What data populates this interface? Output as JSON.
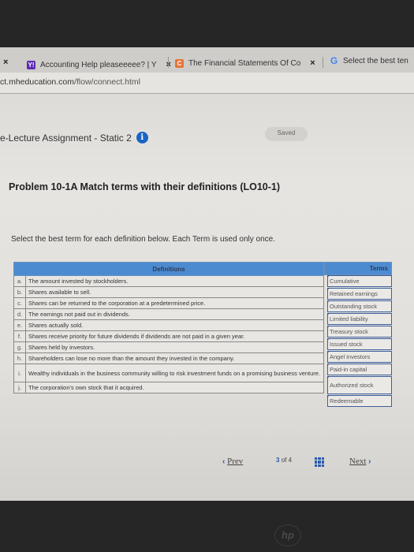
{
  "browser": {
    "tabs": [
      {
        "label": "",
        "favicon": "partial-tab"
      },
      {
        "label": "Accounting Help pleaseeeee? | Y",
        "favicon": "yahoo-icon"
      },
      {
        "label": "The Financial Statements Of Co",
        "favicon": "chegg-icon"
      },
      {
        "label": "Select the best ten",
        "favicon": "google-icon"
      }
    ],
    "close_glyph": "×",
    "url_host": "ct.mheducation.com",
    "url_path": "/flow/connect.html"
  },
  "assignment": {
    "title": "e-Lecture Assignment - Static 2",
    "info_glyph": "i",
    "status": "Saved"
  },
  "problem": {
    "title": "Problem 10-1A Match terms with their definitions (LO10-1)",
    "instructions": "Select the best term for each definition below. Each Term is used only once."
  },
  "definitions": {
    "header": "Definitions",
    "rows": [
      {
        "letter": "a.",
        "text": "The amount invested by stockholders."
      },
      {
        "letter": "b.",
        "text": "Shares available to sell."
      },
      {
        "letter": "c.",
        "text": "Shares can be returned to the corporation at a predetermined price."
      },
      {
        "letter": "d.",
        "text": "The earnings not paid out in dividends."
      },
      {
        "letter": "e.",
        "text": "Shares actually sold."
      },
      {
        "letter": "f.",
        "text": "Shares receive priority for future dividends if dividends are not paid in a given year."
      },
      {
        "letter": "g.",
        "text": "Shares held by investors."
      },
      {
        "letter": "h.",
        "text": "Shareholders can lose no more than the amount they invested in the company."
      },
      {
        "letter": "i.",
        "text": "Wealthy individuals in the business community willing to risk investment funds on a promising business venture."
      },
      {
        "letter": "j.",
        "text": "The corporation's own stock that it acquired."
      }
    ]
  },
  "terms": {
    "header": "Terms",
    "items": [
      "Cumulative",
      "Retained earnings",
      "Outstanding stock",
      "Limited liability",
      "Treasury stock",
      "Issued stock",
      "Angel investors",
      "Paid-in capital",
      "Authorized stock",
      "Redeemable"
    ]
  },
  "pagination": {
    "prev_label": "Prev",
    "prev_glyph": "‹",
    "current": "3",
    "of_label": "of",
    "total": "4",
    "next_label": "Next",
    "next_glyph": "›"
  },
  "taskbar": {
    "apps": [
      "chrome-icon",
      "gmail-icon",
      "docs-icon",
      "youtube-icon"
    ]
  },
  "device": {
    "logo": "hp"
  }
}
